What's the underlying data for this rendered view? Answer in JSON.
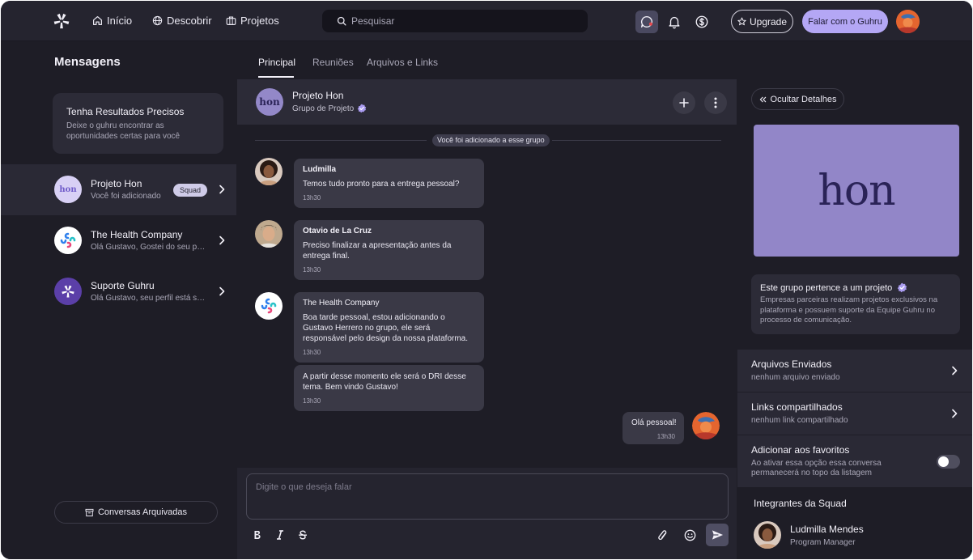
{
  "nav": {
    "links": [
      "Início",
      "Descobrir",
      "Projetos"
    ],
    "search_placeholder": "Pesquisar",
    "upgrade_label": "Upgrade",
    "talk_label": "Falar com o Guhru"
  },
  "sidebar": {
    "title": "Mensagens",
    "promo": {
      "title": "Tenha Resultados Precisos",
      "text": "Deixe o guhru encontrar as oportunidades certas para você"
    },
    "conversations": [
      {
        "name": "Projeto Hon",
        "preview": "Você foi adicionado",
        "badge": "Squad",
        "avatar_text": "hon"
      },
      {
        "name": "The Health Company",
        "preview": "Olá Gustavo, Gostei do seu perfil"
      },
      {
        "name": "Suporte Guhru",
        "preview": "Olá Gustavo, seu perfil está sen..."
      }
    ],
    "archived_label": "Conversas Arquivadas"
  },
  "chat": {
    "tabs": [
      "Principal",
      "Reuniões",
      "Arquivos e Links"
    ],
    "header": {
      "title": "Projeto Hon",
      "subtitle": "Grupo de Projeto",
      "avatar_text": "hon"
    },
    "system_message": "Você foi adicionado a esse grupo",
    "messages": [
      {
        "author": "Ludmilla",
        "text": "Temos tudo pronto para a entrega pessoal?",
        "time": "13h30"
      },
      {
        "author": "Otavio de La Cruz",
        "text": "Preciso finalizar a apresentação antes da entrega final.",
        "time": "13h30"
      },
      {
        "author": "The Health Company",
        "text": "Boa tarde pessoal, estou adicionando o Gustavo Herrero no grupo, ele será responsável pelo design da nossa plataforma.",
        "time": "13h30"
      },
      {
        "author": "",
        "text": "A partir desse momento ele será o DRI desse tema. Bem vindo Gustavo!",
        "time": "13h30"
      }
    ],
    "my_message": {
      "text": "Olá pessoal!",
      "time": "13h30"
    },
    "composer_placeholder": "Digite o que deseja falar"
  },
  "details": {
    "hide_label": "Ocultar Detalhes",
    "logo_text": "hon",
    "info_title": "Este grupo pertence a um projeto",
    "info_text": "Empresas parceiras realizam projetos exclusivos na plataforma e possuem suporte da Equipe Guhru no processo de comunicação.",
    "files": {
      "title": "Arquivos Enviados",
      "sub": "nenhum arquivo enviado"
    },
    "links": {
      "title": "Links compartilhados",
      "sub": "nenhum link compartilhado"
    },
    "favorites": {
      "title": "Adicionar aos favoritos",
      "sub": "Ao ativar essa opção essa conversa permanecerá no topo da listagem",
      "enabled": false
    },
    "squad_title": "Integrantes da Squad",
    "member": {
      "name": "Ludmilla Mendes",
      "role": "Program Manager"
    }
  },
  "colors": {
    "accent": "#B4A7F5",
    "hon_purple": "#9286C8",
    "background": "#1E1D26"
  }
}
